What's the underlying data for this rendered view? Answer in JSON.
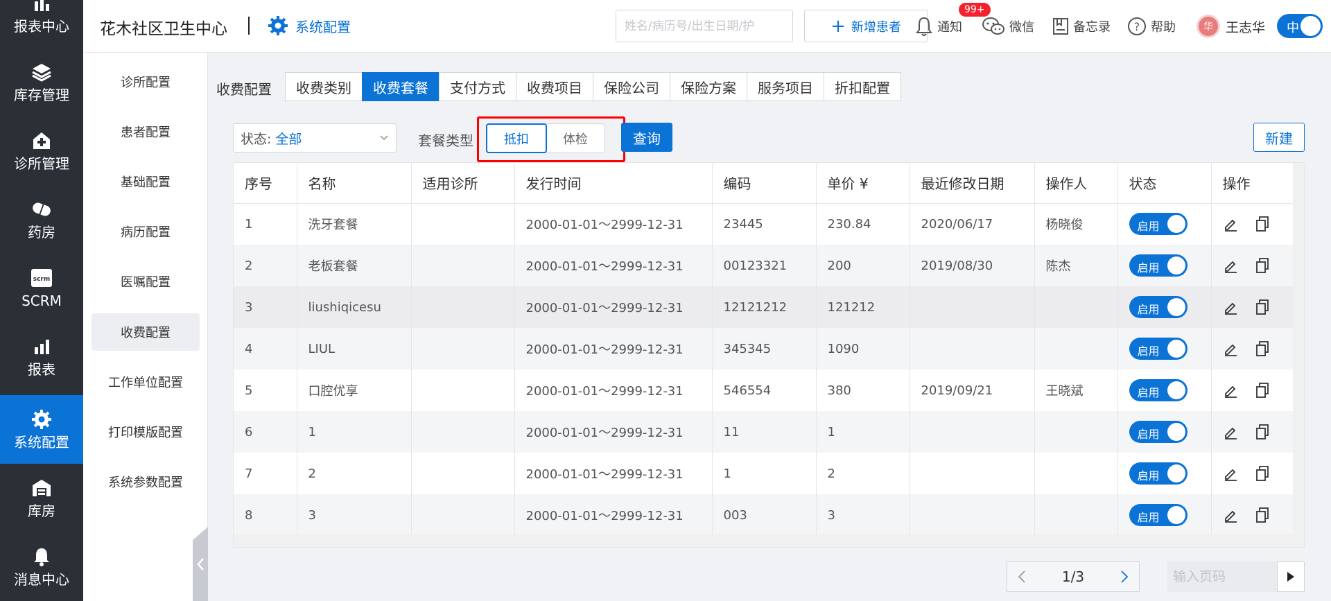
{
  "nav": [
    {
      "label": "报表中心",
      "icon": "chart-icon"
    },
    {
      "label": "库存管理",
      "icon": "layers-icon"
    },
    {
      "label": "诊所管理",
      "icon": "clinic-icon"
    },
    {
      "label": "药房",
      "icon": "pill-icon"
    },
    {
      "label": "SCRM",
      "icon": "scrm-icon",
      "icon_text": "scrm"
    },
    {
      "label": "报表",
      "icon": "bar-chart-icon"
    },
    {
      "label": "系统配置",
      "icon": "gear-icon"
    },
    {
      "label": "库房",
      "icon": "warehouse-icon"
    },
    {
      "label": "消息中心",
      "icon": "bell-icon"
    }
  ],
  "header": {
    "clinic_name": "花木社区卫生中心",
    "section": "系统配置",
    "search_placeholder": "姓名/病历号/出生日期/护",
    "add_patient": "新增患者",
    "notify": "通知",
    "notify_badge": "99+",
    "wechat": "微信",
    "memo": "备忘录",
    "help": "帮助",
    "avatar_text": "华",
    "user": "王志华",
    "lang": "中"
  },
  "sidemenu": [
    "诊所配置",
    "患者配置",
    "基础配置",
    "病历配置",
    "医嘱配置",
    "收费配置",
    "工作单位配置",
    "打印模版配置",
    "系统参数配置"
  ],
  "tabs": {
    "title": "收费配置",
    "items": [
      "收费类别",
      "收费套餐",
      "支付方式",
      "收费项目",
      "保险公司",
      "保险方案",
      "服务项目",
      "折扣配置"
    ],
    "active": 1
  },
  "filters": {
    "status_label": "状态:",
    "status_value": "全部",
    "package_type_label": "套餐类型",
    "package_types": [
      "抵扣",
      "体检"
    ],
    "query": "查询",
    "new": "新建"
  },
  "table": {
    "columns": [
      "序号",
      "名称",
      "适用诊所",
      "发行时间",
      "编码",
      "单价 ¥",
      "最近修改日期",
      "操作人",
      "状态",
      "操作"
    ],
    "status_text": "启用",
    "rows": [
      {
        "no": "1",
        "name": "洗牙套餐",
        "clinic": "",
        "period": "2000-01-01～2999-12-31",
        "code": "23445",
        "price": "230.84",
        "modified": "2020/06/17",
        "operator": "杨晓俊"
      },
      {
        "no": "2",
        "name": "老板套餐",
        "clinic": "",
        "period": "2000-01-01～2999-12-31",
        "code": "00123321",
        "price": "200",
        "modified": "2019/08/30",
        "operator": "陈杰"
      },
      {
        "no": "3",
        "name": "liushiqicesu",
        "clinic": "",
        "period": "2000-01-01～2999-12-31",
        "code": "12121212",
        "price": "121212",
        "modified": "",
        "operator": ""
      },
      {
        "no": "4",
        "name": "LIUL",
        "clinic": "",
        "period": "2000-01-01～2999-12-31",
        "code": "345345",
        "price": "1090",
        "modified": "",
        "operator": ""
      },
      {
        "no": "5",
        "name": "口腔优享",
        "clinic": "",
        "period": "2000-01-01～2999-12-31",
        "code": "546554",
        "price": "380",
        "modified": "2019/09/21",
        "operator": "王晓斌"
      },
      {
        "no": "6",
        "name": "1",
        "clinic": "",
        "period": "2000-01-01～2999-12-31",
        "code": "11",
        "price": "1",
        "modified": "",
        "operator": ""
      },
      {
        "no": "7",
        "name": "2",
        "clinic": "",
        "period": "2000-01-01～2999-12-31",
        "code": "1",
        "price": "2",
        "modified": "",
        "operator": ""
      },
      {
        "no": "8",
        "name": "3",
        "clinic": "",
        "period": "2000-01-01～2999-12-31",
        "code": "003",
        "price": "3",
        "modified": "",
        "operator": ""
      }
    ]
  },
  "pager": {
    "current": "1/3",
    "input_placeholder": "输入页码"
  },
  "colors": {
    "primary": "#0b72d6",
    "nav_bg": "#2b2f36",
    "highlight": "#ff0000"
  }
}
